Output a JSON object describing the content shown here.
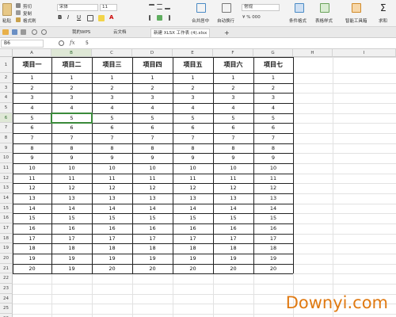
{
  "ribbon": {
    "cut_label": "剪切",
    "copy_label": "复制",
    "format_painter_label": "格式刷",
    "paste_label": "粘贴",
    "font_name": "宋体",
    "font_size": "11",
    "bold_label": "B",
    "italic_label": "I",
    "underline_label": "U",
    "merge_center_label": "合并居中",
    "wrap_label": "自动换行",
    "number_format": "常规",
    "conditional_format_label": "条件格式",
    "table_style_label": "表格样式",
    "smart_toolbox_label": "智能工具箱",
    "sum_label": "求和"
  },
  "tabs": {
    "vps_tab": "我的WPS",
    "cloud_tab": "云文档",
    "doc_tab": "新建 XLSX 工作表 (4).xlsx",
    "add_tab": "+"
  },
  "formula_bar": {
    "name_box": "B6",
    "fx_label": "fx",
    "value": "5"
  },
  "sheet": {
    "columns": [
      "A",
      "B",
      "C",
      "D",
      "E",
      "F",
      "G",
      "H",
      "I"
    ],
    "headers": [
      "项目一",
      "项目二",
      "项目三",
      "项目四",
      "项目五",
      "项目六",
      "项目七"
    ],
    "values": [
      "1",
      "2",
      "3",
      "4",
      "5",
      "6",
      "7",
      "8",
      "9",
      "10",
      "11",
      "12",
      "13",
      "14",
      "15",
      "16",
      "17",
      "18",
      "19",
      "20"
    ],
    "values_b": [
      "1",
      "2",
      "3",
      "4",
      "5",
      "6",
      "7",
      "8",
      "9",
      "10",
      "11",
      "12",
      "13",
      "14",
      "15",
      "16",
      "17",
      "18",
      "19",
      "19"
    ],
    "row_numbers": [
      "1",
      "2",
      "3",
      "4",
      "5",
      "6",
      "7",
      "8",
      "9",
      "10",
      "11",
      "12",
      "13",
      "14",
      "15",
      "16",
      "17",
      "18",
      "19",
      "20",
      "21",
      "22",
      "23",
      "24",
      "25",
      "26"
    ]
  },
  "watermark": "Downyi.com",
  "colors": {
    "selection": "#3a8a3a",
    "watermark": "#e07a12"
  }
}
